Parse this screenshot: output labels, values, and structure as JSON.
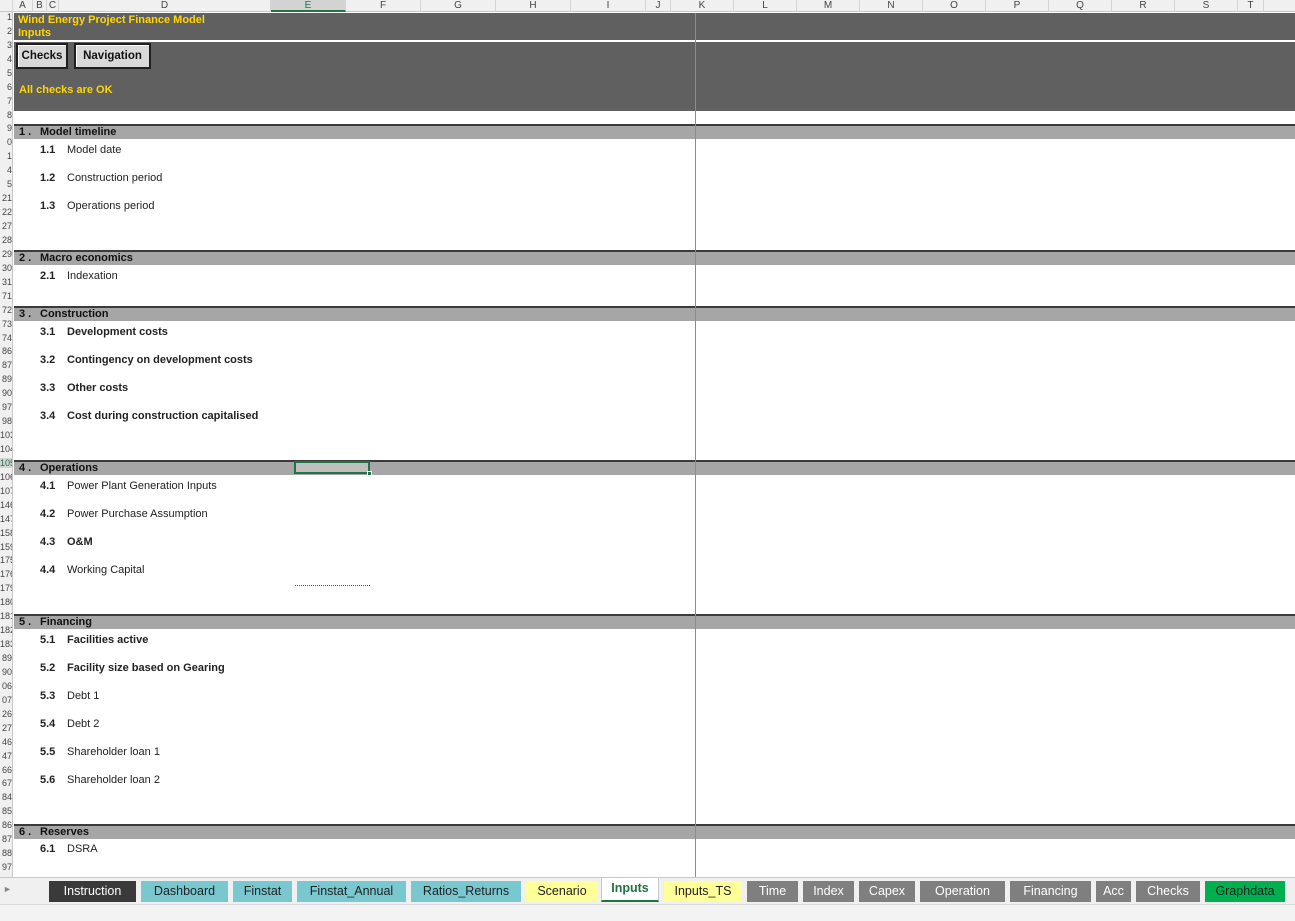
{
  "columns": [
    "A",
    "B",
    "C",
    "D",
    "E",
    "F",
    "G",
    "H",
    "I",
    "J",
    "K",
    "L",
    "M",
    "N",
    "O",
    "P",
    "Q",
    "R",
    "S",
    "T"
  ],
  "active_column": "E",
  "row_numbers": [
    "1",
    "2",
    "3",
    "4",
    "5",
    "6",
    "7",
    "8",
    "9",
    "0",
    "1",
    "4",
    "5",
    "21",
    "22",
    "27",
    "28",
    "29",
    "30",
    "31",
    "71",
    "72",
    "73",
    "74",
    "86",
    "87",
    "89",
    "90",
    "97",
    "98",
    "103",
    "104",
    "105",
    "106",
    "107",
    "146",
    "147",
    "158",
    "159",
    "175",
    "176",
    "179",
    "180",
    "181",
    "182",
    "183",
    "89",
    "90",
    "06",
    "07",
    "26",
    "27",
    "46",
    "47",
    "66",
    "67",
    "84",
    "85",
    "86",
    "87",
    "88",
    "97"
  ],
  "active_row": "105",
  "header": {
    "title": "Wind Energy Project Finance Model",
    "subtitle": "Inputs",
    "checks_button": "Checks",
    "navigation_button": "Navigation",
    "check_status": "All checks are OK"
  },
  "sections": [
    {
      "num": "1 .",
      "title": "Model timeline",
      "items": [
        {
          "num": "1.1",
          "label": "Model date",
          "bold": false
        },
        {
          "num": "1.2",
          "label": "Construction period",
          "bold": false
        },
        {
          "num": "1.3",
          "label": "Operations period",
          "bold": false
        }
      ]
    },
    {
      "num": "2 .",
      "title": "Macro economics",
      "items": [
        {
          "num": "2.1",
          "label": "Indexation",
          "bold": false
        }
      ]
    },
    {
      "num": "3 .",
      "title": "Construction",
      "items": [
        {
          "num": "3.1",
          "label": "Development costs",
          "bold": true
        },
        {
          "num": "3.2",
          "label": "Contingency on development costs",
          "bold": true
        },
        {
          "num": "3.3",
          "label": "Other costs",
          "bold": true
        },
        {
          "num": "3.4",
          "label": "Cost during construction capitalised",
          "bold": true
        }
      ]
    },
    {
      "num": "4 .",
      "title": "Operations",
      "items": [
        {
          "num": "4.1",
          "label": "Power Plant Generation Inputs",
          "bold": false
        },
        {
          "num": "4.2",
          "label": "Power Purchase Assumption",
          "bold": false
        },
        {
          "num": "4.3",
          "label": "O&M",
          "bold": true
        },
        {
          "num": "4.4",
          "label": "Working Capital",
          "bold": false
        }
      ]
    },
    {
      "num": "5 .",
      "title": "Financing",
      "items": [
        {
          "num": "5.1",
          "label": "Facilities active",
          "bold": true
        },
        {
          "num": "5.2",
          "label": "Facility size based on Gearing",
          "bold": true
        },
        {
          "num": "5.3",
          "label": "Debt 1",
          "bold": false
        },
        {
          "num": "5.4",
          "label": "Debt 2",
          "bold": false
        },
        {
          "num": "5.5",
          "label": "Shareholder loan 1",
          "bold": false
        },
        {
          "num": "5.6",
          "label": "Shareholder loan 2",
          "bold": false
        }
      ]
    },
    {
      "num": "6 .",
      "title": "Reserves",
      "items": [
        {
          "num": "6.1",
          "label": "DSRA",
          "bold": false
        }
      ]
    }
  ],
  "tabs": [
    {
      "label": "Instruction",
      "bg": "#3a3a3a",
      "fg": "#ffffff",
      "active": false
    },
    {
      "label": "Dashboard",
      "bg": "#7ac8cf",
      "fg": "#222222",
      "active": false
    },
    {
      "label": "Finstat",
      "bg": "#7ac8cf",
      "fg": "#222222",
      "active": false
    },
    {
      "label": "Finstat_Annual",
      "bg": "#7ac8cf",
      "fg": "#222222",
      "active": false
    },
    {
      "label": "Ratios_Returns",
      "bg": "#7ac8cf",
      "fg": "#222222",
      "active": false
    },
    {
      "label": "Scenario",
      "bg": "#ffff99",
      "fg": "#222222",
      "active": false
    },
    {
      "label": "Inputs",
      "bg": "#ffffff",
      "fg": "#217346",
      "active": true
    },
    {
      "label": "Inputs_TS",
      "bg": "#ffff99",
      "fg": "#222222",
      "active": false
    },
    {
      "label": "Time",
      "bg": "#7f7f7f",
      "fg": "#ffffff",
      "active": false
    },
    {
      "label": "Index",
      "bg": "#7f7f7f",
      "fg": "#ffffff",
      "active": false
    },
    {
      "label": "Capex",
      "bg": "#7f7f7f",
      "fg": "#ffffff",
      "active": false
    },
    {
      "label": "Operation",
      "bg": "#7f7f7f",
      "fg": "#ffffff",
      "active": false
    },
    {
      "label": "Financing",
      "bg": "#7f7f7f",
      "fg": "#ffffff",
      "active": false
    },
    {
      "label": "Acc",
      "bg": "#7f7f7f",
      "fg": "#ffffff",
      "active": false
    },
    {
      "label": "Checks",
      "bg": "#7f7f7f",
      "fg": "#ffffff",
      "active": false
    },
    {
      "label": "Graphdata",
      "bg": "#00b050",
      "fg": "#222222",
      "active": false
    }
  ]
}
